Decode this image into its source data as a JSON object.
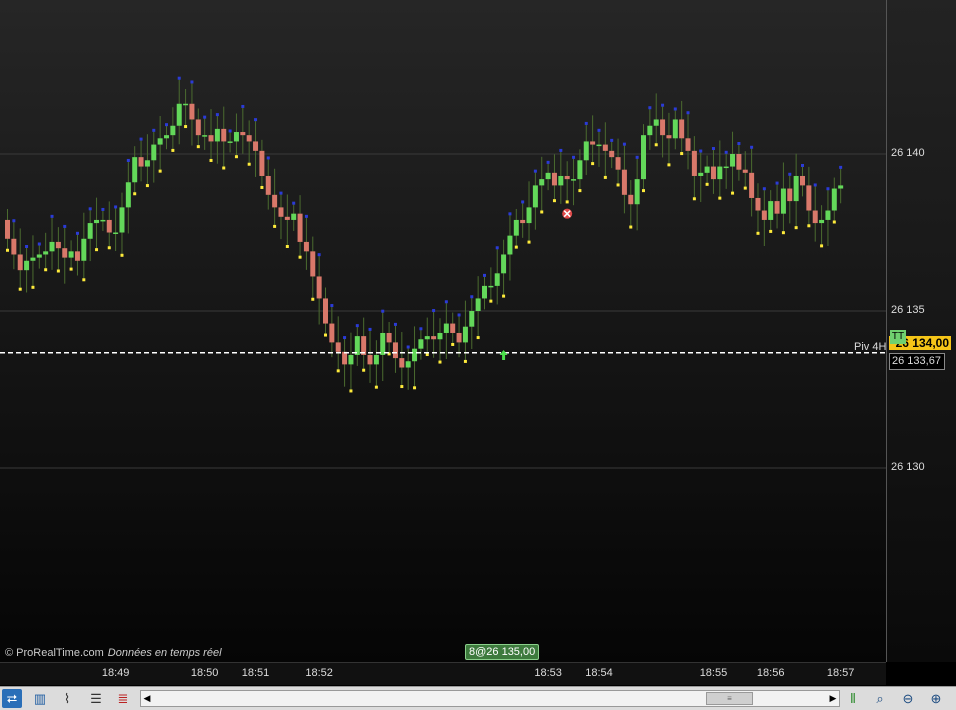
{
  "chart_data": {
    "type": "candlestick",
    "y_ticks": [
      "26 140",
      "26 135",
      "26 130"
    ],
    "y_tick_values": [
      26140,
      26135,
      26130
    ],
    "ylim": [
      26124.6,
      26144.7
    ],
    "x_ticks": [
      "18:49",
      "18:50",
      "18:51",
      "18:52",
      "18:53",
      "18:54",
      "18:55",
      "18:56",
      "18:57"
    ],
    "x_tick_bar_index": [
      17,
      31,
      39,
      49,
      85,
      93,
      111,
      120,
      131
    ],
    "grid": true,
    "up_color": "#63d85a",
    "down_color": "#d9786a",
    "pivot": {
      "label": "Piv 4H",
      "value": "26 133,67",
      "numeric": 26133.67
    },
    "current_price": "26 134,00",
    "current_price_numeric": 26134.0,
    "current_marker": "TT",
    "crosshair_label": "8@26 135,00",
    "closes": [
      26137.3,
      26136.8,
      26136.3,
      26136.6,
      26136.7,
      26136.8,
      26136.9,
      26137.2,
      26137.0,
      26136.7,
      26136.9,
      26136.6,
      26137.3,
      26137.8,
      26137.9,
      26137.9,
      26137.5,
      26137.5,
      26138.3,
      26139.1,
      26139.9,
      26139.6,
      26139.8,
      26140.3,
      26140.5,
      26140.6,
      26140.9,
      26141.6,
      26141.6,
      26141.1,
      26140.6,
      26140.6,
      26140.4,
      26140.8,
      26140.4,
      26140.4,
      26140.7,
      26140.6,
      26140.4,
      26140.1,
      26139.3,
      26138.7,
      26138.3,
      26138.0,
      26137.9,
      26138.1,
      26137.2,
      26136.9,
      26136.1,
      26135.4,
      26134.6,
      26134.0,
      26133.7,
      26133.3,
      26133.6,
      26134.2,
      26133.6,
      26133.3,
      26133.6,
      26134.3,
      26134.0,
      26133.5,
      26133.2,
      26133.4,
      26133.8,
      26134.1,
      26134.2,
      26134.1,
      26134.3,
      26134.6,
      26134.3,
      26134.0,
      26134.5,
      26135.0,
      26135.4,
      26135.8,
      26135.8,
      26136.2,
      26136.8,
      26137.4,
      26137.9,
      26137.8,
      26138.3,
      26139.0,
      26139.2,
      26139.4,
      26139.0,
      26139.3,
      26139.2,
      26139.2,
      26139.8,
      26140.4,
      26140.3,
      26140.3,
      26140.1,
      26139.9,
      26139.5,
      26138.7,
      26138.4,
      26139.2,
      26140.6,
      26140.9,
      26141.1,
      26140.6,
      26140.5,
      26141.1,
      26140.5,
      26140.1,
      26139.3,
      26139.4,
      26139.6,
      26139.2,
      26139.6,
      26139.6,
      26140.0,
      26139.5,
      26139.4,
      26138.6,
      26138.2,
      26137.9,
      26138.5,
      26138.1,
      26138.9,
      26138.5,
      26139.3,
      26139.0,
      26138.2,
      26137.8,
      26137.9,
      26138.2,
      26138.9,
      26139.0
    ],
    "opens": [
      26137.9,
      26137.3,
      26136.8,
      26136.3,
      26136.6,
      26136.7,
      26136.8,
      26136.9,
      26137.2,
      26137.0,
      26136.7,
      26136.9,
      26136.6,
      26137.3,
      26137.8,
      26137.9,
      26137.9,
      26137.5,
      26137.5,
      26138.3,
      26139.1,
      26139.9,
      26139.6,
      26139.8,
      26140.3,
      26140.5,
      26140.6,
      26140.9,
      26141.6,
      26141.6,
      26141.1,
      26140.6,
      26140.6,
      26140.4,
      26140.8,
      26140.4,
      26140.4,
      26140.7,
      26140.6,
      26140.4,
      26140.1,
      26139.3,
      26138.7,
      26138.3,
      26138.0,
      26137.9,
      26138.1,
      26137.2,
      26136.9,
      26136.1,
      26135.4,
      26134.6,
      26134.0,
      26133.7,
      26133.3,
      26133.6,
      26134.2,
      26133.6,
      26133.3,
      26133.6,
      26134.3,
      26134.0,
      26133.5,
      26133.2,
      26133.4,
      26133.8,
      26134.1,
      26134.2,
      26134.1,
      26134.3,
      26134.6,
      26134.3,
      26134.0,
      26134.5,
      26135.0,
      26135.4,
      26135.8,
      26135.8,
      26136.2,
      26136.8,
      26137.4,
      26137.9,
      26137.8,
      26138.3,
      26139.0,
      26139.2,
      26139.4,
      26139.0,
      26139.3,
      26139.2,
      26139.2,
      26139.8,
      26140.4,
      26140.3,
      26140.3,
      26140.1,
      26139.9,
      26139.5,
      26138.7,
      26138.4,
      26139.2,
      26140.6,
      26140.9,
      26141.1,
      26140.6,
      26140.5,
      26141.1,
      26140.5,
      26140.1,
      26139.3,
      26139.4,
      26139.6,
      26139.2,
      26139.6,
      26139.6,
      26140.0,
      26139.5,
      26139.4,
      26138.6,
      26138.2,
      26137.9,
      26138.5,
      26138.1,
      26138.9,
      26138.5,
      26139.3,
      26139.0,
      26138.2,
      26137.8,
      26137.9,
      26138.2,
      26138.9
    ]
  },
  "copyright": {
    "brand": "© ProRealTime.com",
    "note": "Données en temps réel"
  },
  "toolbar": {
    "icons": [
      "share-icon",
      "chart-type-icon",
      "indicator-icon",
      "list-icon",
      "orders-icon",
      "scroll-left-icon",
      "scroll-right-icon",
      "candles-icon",
      "zoom-fit-icon",
      "zoom-out-icon",
      "zoom-in-icon"
    ]
  }
}
